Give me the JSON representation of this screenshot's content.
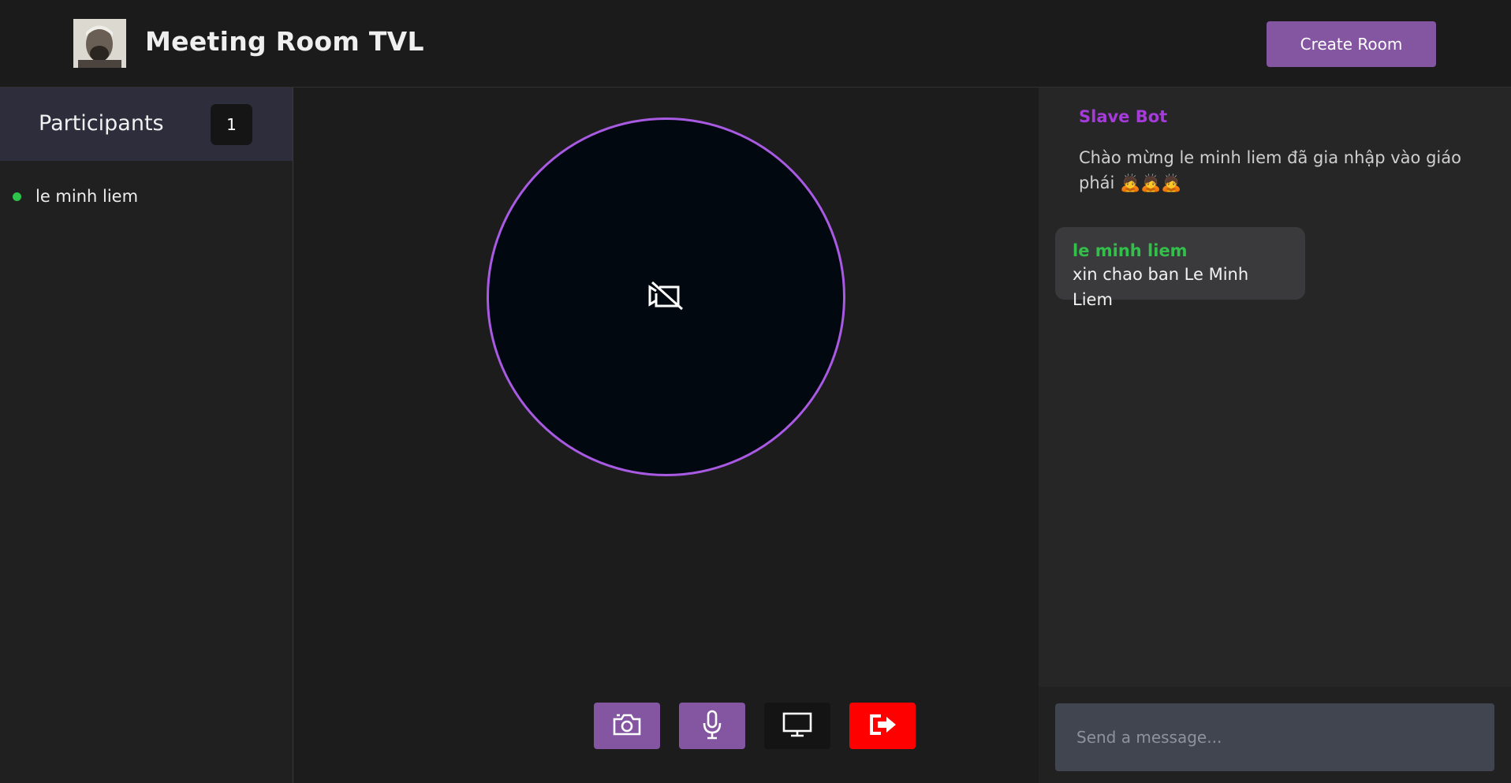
{
  "header": {
    "title": "Meeting Room TVL",
    "create_room_label": "Create Room"
  },
  "participants": {
    "title": "Participants",
    "count": "1",
    "list": [
      {
        "name": "le minh liem",
        "status": "online"
      }
    ]
  },
  "video": {
    "state_icon": "video-off-icon",
    "accent_color": "#a95ae3"
  },
  "controls": {
    "camera_icon": "camera-icon",
    "mic_icon": "microphone-icon",
    "screen_icon": "monitor-icon",
    "leave_icon": "leave-icon"
  },
  "chat": {
    "messages": [
      {
        "sender": "Slave Bot",
        "text": "Chào mừng le minh liem đã gia nhập vào giáo phái 🙇🙇🙇"
      },
      {
        "sender": "le minh liem",
        "text": "xin chao ban Le Minh Liem"
      }
    ],
    "input_placeholder": "Send a message..."
  },
  "colors": {
    "brand_purple": "#8455a1",
    "online_green": "#2ec34a",
    "leave_red": "#ff0000",
    "bot_name": "#a53bd9"
  }
}
